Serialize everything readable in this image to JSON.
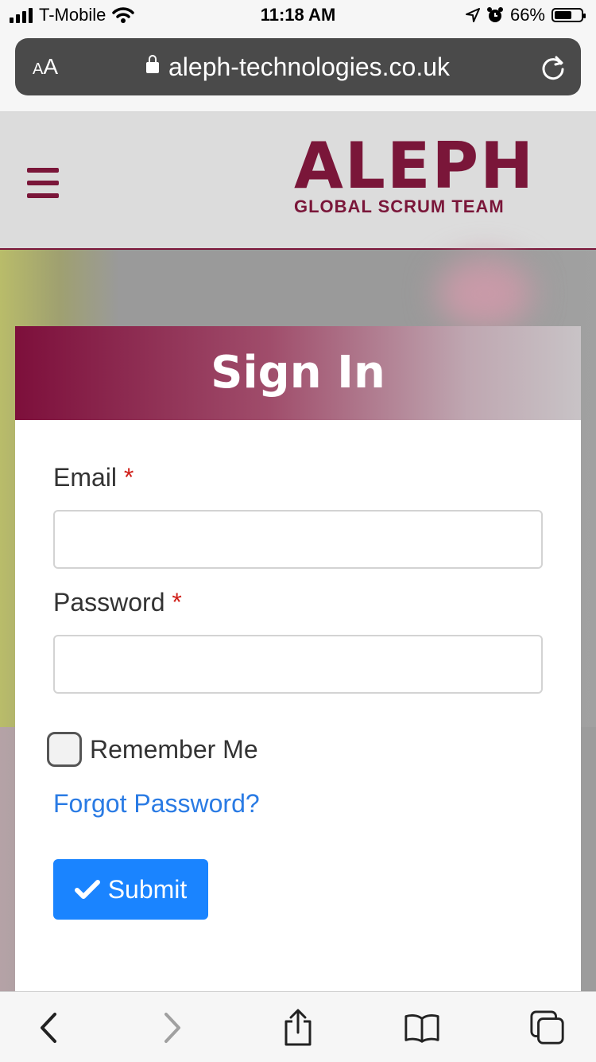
{
  "status_bar": {
    "carrier": "T-Mobile",
    "time": "11:18 AM",
    "battery": "66%",
    "battery_level": 0.66
  },
  "browser": {
    "text_size_label": "AA",
    "url": "aleph-technologies.co.uk"
  },
  "header": {
    "logo_text": "ALEPH",
    "logo_subtext": "GLOBAL SCRUM TEAM"
  },
  "signin": {
    "title": "Sign In",
    "email_label": "Email",
    "email_value": "",
    "password_label": "Password",
    "password_value": "",
    "required_marker": "*",
    "remember_label": "Remember Me",
    "remember_checked": false,
    "forgot_link": "Forgot Password?",
    "submit_label": "Submit"
  },
  "colors": {
    "brand": "#7a1639",
    "link": "#2a7be4",
    "button": "#1a84ff"
  }
}
